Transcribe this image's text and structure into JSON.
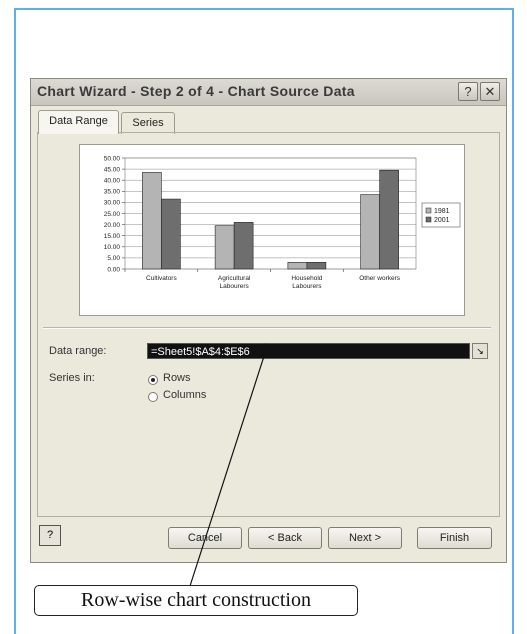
{
  "dialog": {
    "title": "Chart Wizard - Step 2 of 4 - Chart Source Data",
    "help_glyph": "?",
    "close_glyph": "✕"
  },
  "tabs": [
    {
      "label": "Data Range",
      "active": true
    },
    {
      "label": "Series",
      "active": false
    }
  ],
  "chart_data": {
    "type": "bar",
    "categories": [
      "Cultivators",
      "Agricultural Labourers",
      "Household Labourers",
      "Other workers"
    ],
    "category_lines": [
      [
        "Cultivators"
      ],
      [
        "Agricultural",
        "Labourers"
      ],
      [
        "Household",
        "Labourers"
      ],
      [
        "Other workers"
      ]
    ],
    "series": [
      {
        "name": "1981",
        "values": [
          43.5,
          19.5,
          3.0,
          33.5
        ],
        "color": "#b4b4b4"
      },
      {
        "name": "2001",
        "values": [
          31.5,
          21.0,
          3.0,
          44.5
        ],
        "color": "#6e6e6e"
      }
    ],
    "yticks": [
      "50.00",
      "45.00",
      "40.00",
      "35.00",
      "30.00",
      "25.00",
      "20.00",
      "15.00",
      "10.00",
      "5.00",
      "0.00"
    ],
    "ylim": [
      0,
      50
    ],
    "grid": true,
    "legend": "right"
  },
  "form": {
    "data_range_label": "Data range:",
    "data_range_value": "=Sheet5!$A$4:$E$6",
    "series_in_label": "Series in:",
    "option_rows": "Rows",
    "option_columns": "Columns",
    "selected": "Rows"
  },
  "buttons": {
    "help": "?",
    "cancel": "Cancel",
    "back": "< Back",
    "next": "Next >",
    "finish": "Finish"
  },
  "annotation": {
    "callout_text": "Row-wise chart construction"
  }
}
